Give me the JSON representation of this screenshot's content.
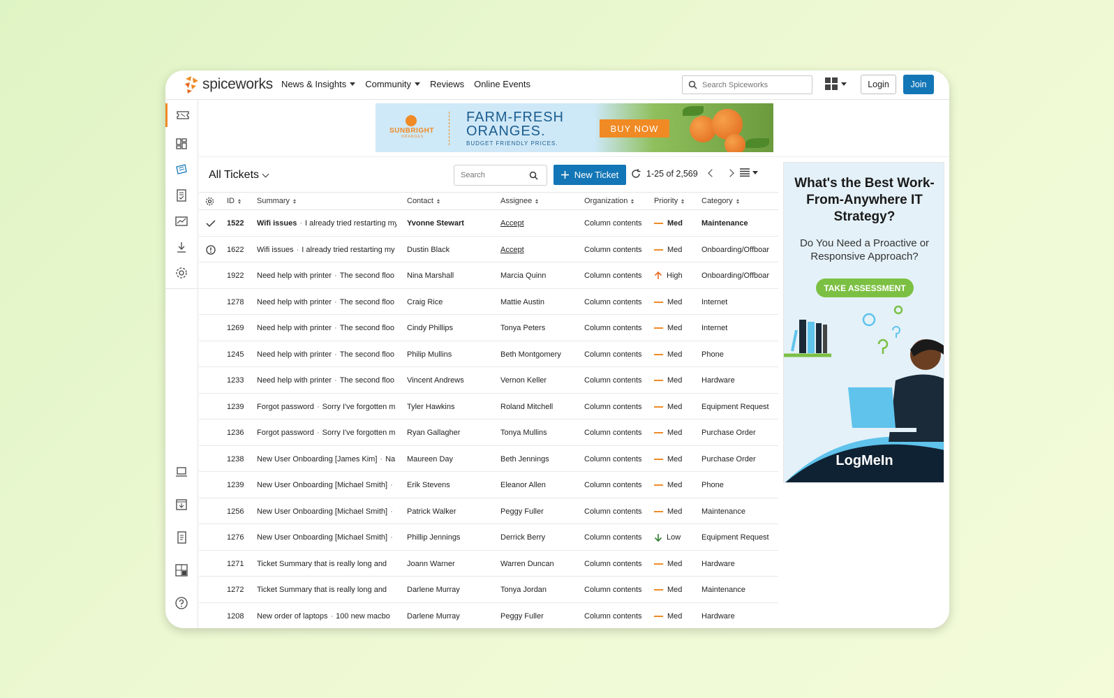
{
  "nav": {
    "brand": "spiceworks",
    "links": [
      {
        "label": "News & Insights",
        "has_menu": true
      },
      {
        "label": "Community",
        "has_menu": true
      },
      {
        "label": "Reviews",
        "has_menu": false
      },
      {
        "label": "Online Events",
        "has_menu": false
      }
    ],
    "search_placeholder": "Search Spiceworks",
    "login_label": "Login",
    "join_label": "Join"
  },
  "colors": {
    "accent": "#1376b6",
    "brand_orange": "#f08a24",
    "ad_green": "#7cc043"
  },
  "banner_ad": {
    "brand": "SUNBRIGHT",
    "brand_sub": "ORANGES",
    "headline": "FARM-FRESH ORANGES.",
    "tagline": "BUDGET FRIENDLY PRICES.",
    "cta": "BUY NOW"
  },
  "sidebar": {
    "items": [
      {
        "icon": "ticket-icon",
        "active": true
      },
      {
        "icon": "dashboard-icon"
      },
      {
        "icon": "tickets-stack-icon"
      },
      {
        "icon": "checklist-icon"
      },
      {
        "icon": "reports-icon"
      },
      {
        "icon": "download-icon"
      },
      {
        "icon": "gear-icon"
      },
      {
        "icon": "laptop-icon"
      },
      {
        "icon": "inbox-download-icon"
      },
      {
        "icon": "document-icon"
      },
      {
        "icon": "layout-icon"
      },
      {
        "icon": "help-icon"
      }
    ]
  },
  "tickets": {
    "view_title": "All Tickets",
    "search_placeholder": "Search",
    "new_ticket_label": "New Ticket",
    "page_range": "1-25 of 2,569",
    "columns": [
      "ID",
      "Summary",
      "Contact",
      "Assignee",
      "Organization",
      "Priority",
      "Category"
    ],
    "rows": [
      {
        "status": "check",
        "id": "1522",
        "title": "Wifi issues",
        "desc": "I already tried restarting my",
        "contact": "Yvonne Stewart",
        "assignee": "Accept",
        "org": "Column contents",
        "priority": "Med",
        "category": "Maintenance",
        "bold": true
      },
      {
        "status": "alert",
        "id": "1622",
        "title": "Wifi issues",
        "desc": "I already tried restarting my",
        "contact": "Dustin Black",
        "assignee": "Accept",
        "org": "Column contents",
        "priority": "Med",
        "category": "Onboarding/Offboar"
      },
      {
        "id": "1922",
        "title": "Need help with printer",
        "desc": "The second floo",
        "contact": "Nina Marshall",
        "assignee": "Marcia Quinn",
        "org": "Column contents",
        "priority": "High",
        "category": "Onboarding/Offboar"
      },
      {
        "id": "1278",
        "title": "Need help with printer",
        "desc": "The second floo",
        "contact": "Craig Rice",
        "assignee": "Mattie Austin",
        "org": "Column contents",
        "priority": "Med",
        "category": "Internet"
      },
      {
        "id": "1269",
        "title": "Need help with printer",
        "desc": "The second floo",
        "contact": "Cindy Phillips",
        "assignee": "Tonya Peters",
        "org": "Column contents",
        "priority": "Med",
        "category": "Internet"
      },
      {
        "id": "1245",
        "title": "Need help with printer",
        "desc": "The second floo",
        "contact": "Philip Mullins",
        "assignee": "Beth Montgomery",
        "org": "Column contents",
        "priority": "Med",
        "category": "Phone"
      },
      {
        "id": "1233",
        "title": "Need help with printer",
        "desc": "The second floo",
        "contact": "Vincent Andrews",
        "assignee": "Vernon Keller",
        "org": "Column contents",
        "priority": "Med",
        "category": "Hardware"
      },
      {
        "id": "1239",
        "title": "Forgot password",
        "desc": "Sorry I've forgotten m",
        "contact": "Tyler Hawkins",
        "assignee": "Roland Mitchell",
        "org": "Column contents",
        "priority": "Med",
        "category": "Equipment Request"
      },
      {
        "id": "1236",
        "title": "Forgot password",
        "desc": "Sorry I've forgotten m",
        "contact": "Ryan Gallagher",
        "assignee": "Tonya Mullins",
        "org": "Column contents",
        "priority": "Med",
        "category": "Purchase Order"
      },
      {
        "id": "1238",
        "title": "New User Onboarding [James Kim]",
        "desc": "Na",
        "contact": "Maureen Day",
        "assignee": "Beth Jennings",
        "org": "Column contents",
        "priority": "Med",
        "category": "Purchase Order"
      },
      {
        "id": "1239",
        "title": "New User Onboarding [Michael Smith]",
        "desc": "",
        "contact": "Erik Stevens",
        "assignee": "Eleanor Allen",
        "org": "Column contents",
        "priority": "Med",
        "category": "Phone"
      },
      {
        "id": "1256",
        "title": "New User Onboarding [Michael Smith]",
        "desc": "",
        "contact": "Patrick Walker",
        "assignee": "Peggy Fuller",
        "org": "Column contents",
        "priority": "Med",
        "category": "Maintenance"
      },
      {
        "id": "1276",
        "title": "New User Onboarding [Michael Smith]",
        "desc": "",
        "contact": "Phillip Jennings",
        "assignee": "Derrick Berry",
        "org": "Column contents",
        "priority": "Low",
        "category": "Equipment Request"
      },
      {
        "id": "1271",
        "title": "Ticket Summary that is really long and",
        "desc": null,
        "contact": "Joann Warner",
        "assignee": "Warren Duncan",
        "org": "Column contents",
        "priority": "Med",
        "category": "Hardware"
      },
      {
        "id": "1272",
        "title": "Ticket Summary that is really long and",
        "desc": null,
        "contact": "Darlene Murray",
        "assignee": "Tonya Jordan",
        "org": "Column contents",
        "priority": "Med",
        "category": "Maintenance"
      },
      {
        "id": "1208",
        "title": "New order of laptops",
        "desc": "100 new macbo",
        "contact": "Darlene Murray",
        "assignee": "Peggy Fuller",
        "org": "Column contents",
        "priority": "Med",
        "category": "Hardware"
      }
    ]
  },
  "side_ad": {
    "headline": "What's the Best Work-From-Anywhere IT Strategy?",
    "subhead": "Do You Need a Proactive or Responsive Approach?",
    "cta": "TAKE ASSESSMENT",
    "brand": "LogMeIn"
  }
}
